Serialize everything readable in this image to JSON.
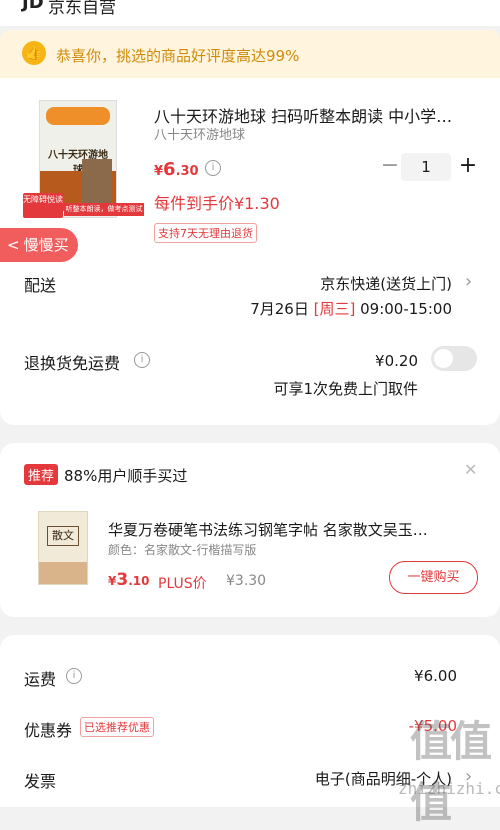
{
  "header": {
    "logo": "JD",
    "shop_name": "京东自营"
  },
  "banner": {
    "icon": "thumbs-up-icon",
    "text": "恭喜你，挑选的商品好评度高达99%"
  },
  "product": {
    "title": "八十天环游地球 扫码听整本朗读 中小学…",
    "subtitle": "八十天环游地球",
    "price_symbol": "¥",
    "price_int": "6",
    "price_dec": ".30",
    "quantity": "1",
    "each_price": "每件到手价¥1.30",
    "return_policy": "支持7天无理由退货",
    "cover": {
      "series": "小小学而思",
      "title": "八十天环游地球",
      "tag": "无障碍悦读",
      "foot": "听整本朗读，做考点测试"
    }
  },
  "slow_buy": {
    "label": "慢慢买",
    "arrow": "<"
  },
  "shipping": {
    "label": "配送",
    "method": "京东快递(送货上门)",
    "date": "7月26日",
    "weekday": "[周三]",
    "time": "09:00-15:00"
  },
  "return_freight": {
    "label": "退换货免运费",
    "price": "¥0.20",
    "desc": "可享1次免费上门取件",
    "enabled": false
  },
  "recommend": {
    "badge": "推荐",
    "title": "88%用户顺手买过",
    "item_name": "华夏万卷硬笔书法练习钢笔字帖 名家散文吴玉…",
    "spec": "颜色：名家散文-行楷描写版",
    "price_symbol": "¥",
    "price_int": "3",
    "price_dec": ".10",
    "plus_label": "PLUS价",
    "plus_price": "¥3.30",
    "button": "一键购买",
    "cover_title": "散文"
  },
  "summary": {
    "freight_label": "运费",
    "freight_value": "¥6.00",
    "coupon_label": "优惠券",
    "coupon_tag": "已选推荐优惠",
    "coupon_value": "-¥5.00",
    "invoice_label": "发票",
    "invoice_value": "电子(商品明细-个人)"
  },
  "watermark": {
    "main": "值值值",
    "sub": "zhizhizhi.com"
  },
  "colors": {
    "accent": "#e4393c",
    "banner_bg": "#fff5de",
    "banner_text": "#d18a0a",
    "slow_buy": "#f15c5c"
  }
}
